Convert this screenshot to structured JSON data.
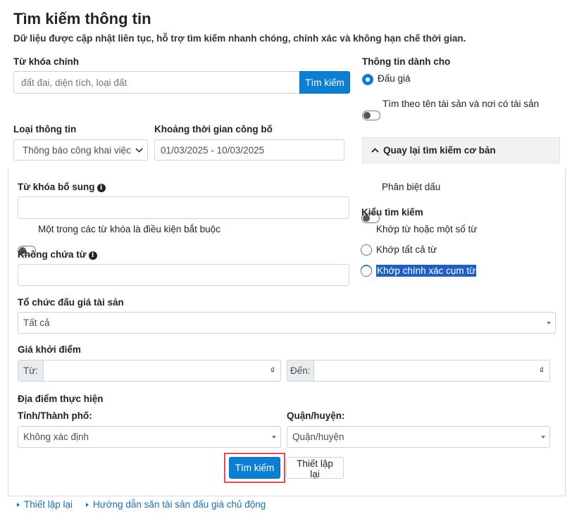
{
  "header": {
    "title": "Tìm kiếm thông tin",
    "subtitle": "Dữ liệu được cập nhật liên tục, hỗ trợ tìm kiếm nhanh chóng, chính xác và không hạn chế thời gian."
  },
  "main_search": {
    "label": "Từ khóa chính",
    "placeholder": "đất đai, diện tích, loại đất",
    "button_label": "Tìm kiếm"
  },
  "info_for": {
    "label": "Thông tin dành cho",
    "option_auction": "Đấu giá",
    "toggle_label": "Tìm theo tên tài sản và nơi có tài sản"
  },
  "info_type": {
    "label": "Loại thông tin",
    "selected": "Thông báo công khai việc"
  },
  "date_range": {
    "label": "Khoảng thời gian công bố",
    "value": "01/03/2025 - 10/03/2025"
  },
  "back_basic": {
    "label": "Quay lại tìm kiếm cơ bản"
  },
  "advanced": {
    "extra_keyword_label": "Từ khóa bổ sung",
    "one_of_keywords_label": "Một trong các từ khóa là điều kiện bắt buộc",
    "exclude_label": "Không chứa từ",
    "diacritics_label": "Phân biệt dấu",
    "search_mode_label": "Kiểu tìm kiếm",
    "mode_options": [
      "Khớp từ hoặc một số từ",
      "Khớp tất cả từ",
      "Khớp chính xác cụm từ"
    ],
    "org_label": "Tổ chức đấu giá tài sản",
    "org_selected": "Tất cả",
    "price_label": "Giá khởi điểm",
    "price_from_label": "Từ:",
    "price_to_label": "Đến:",
    "currency": "₫",
    "location_label": "Địa điểm thực hiện",
    "province_label": "Tỉnh/Thành phố:",
    "province_selected": "Không xác định",
    "district_label": "Quận/huyện:",
    "district_selected": "Quận/huyện",
    "search_button": "Tìm kiếm",
    "reset_button": "Thiết lập lại"
  },
  "footer_links": [
    "Thiết lập lại",
    "Hướng dẫn săn tài sản đấu giá chủ động"
  ]
}
